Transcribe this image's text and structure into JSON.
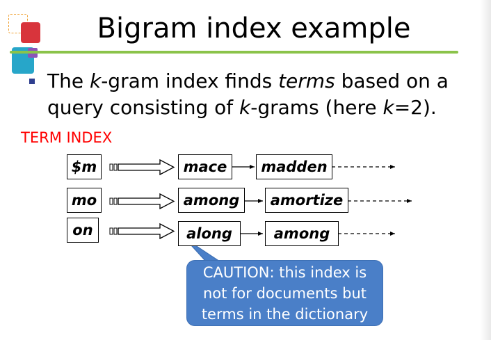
{
  "slide": {
    "title": "Bigram index example",
    "bullet": {
      "p1": "The ",
      "p2": "k",
      "p3": "-gram index finds ",
      "p4": "terms",
      "p5": " based on a query consisting of ",
      "p6": "k",
      "p7": "-grams (here ",
      "p8": "k",
      "p9": "=2)."
    },
    "term_index_label": "TERM INDEX",
    "rows": [
      {
        "bigram": "$m",
        "terms": [
          "mace",
          "madden"
        ]
      },
      {
        "bigram": "mo",
        "terms": [
          "among",
          "amortize"
        ]
      },
      {
        "bigram": "on",
        "terms": [
          "along",
          "among"
        ]
      }
    ],
    "caution": {
      "line1": "CAUTION: this index is",
      "line2": "not for documents but",
      "line3": "terms in the dictionary"
    },
    "colors": {
      "title_rule": "#8bc34a",
      "term_index_label": "#ff0000",
      "callout_fill": "#4a7fc8",
      "bullet": "#2f3f8f"
    }
  }
}
